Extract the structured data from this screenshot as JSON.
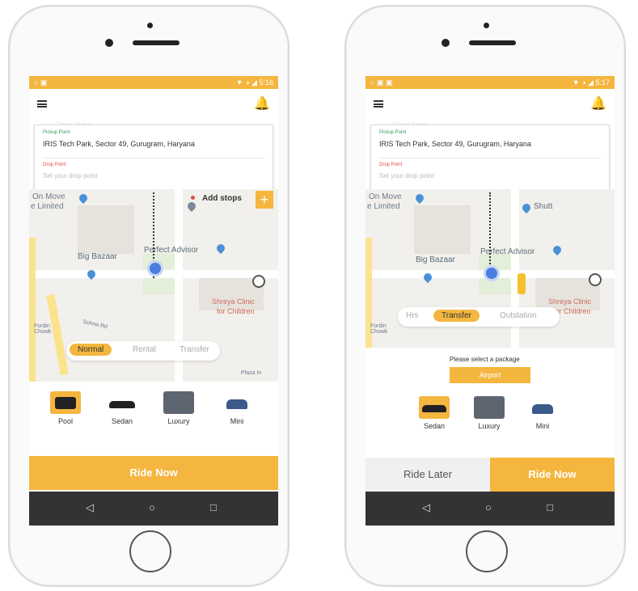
{
  "colors": {
    "accent": "#f4b63f",
    "nav_bar": "#333333",
    "pickup_label": "#3a9b58",
    "drop_label": "#e24b4b"
  },
  "left": {
    "status": {
      "left": "○ ▣",
      "right": "▼ ◑ ◢ 5:16"
    },
    "pickup_label": "Pickup Point",
    "pickup_value": "IRIS Tech Park, Sector 49, Gurugram, Haryana",
    "drop_label": "Drop Point",
    "drop_placeholder": "Set your drop point",
    "add_stops": "Add stops",
    "map_labels": {
      "on_move": "On Move",
      "limited": "e Limited",
      "big_bazaar": "Big Bazaar",
      "perfect_advisor": "Perfect Advisor",
      "clinic1": "Shreya Clinic",
      "clinic2": "for Children",
      "fordin": "Fordin Chowk",
      "sohna": "Sohna Rd",
      "plaza": "Plaza In",
      "top_faint": "Cibera Nebia"
    },
    "tabs": [
      {
        "label": "Normal",
        "active": true
      },
      {
        "label": "Rental",
        "active": false
      },
      {
        "label": "Transfer",
        "active": false
      }
    ],
    "cars": [
      {
        "label": "Pool",
        "icon": "suv-icon",
        "selected": true
      },
      {
        "label": "Sedan",
        "icon": "sedan-icon",
        "selected": false
      },
      {
        "label": "Luxury",
        "icon": "luxury-car-icon",
        "selected": false
      },
      {
        "label": "Mini",
        "icon": "mini-car-icon",
        "selected": false
      }
    ],
    "ride_now": "Ride Now"
  },
  "right": {
    "status": {
      "left": "○ ▣ ▣",
      "right": "▼ ◑ ◢ 5:17"
    },
    "pickup_label": "Pickup Point",
    "pickup_value": "IRIS Tech Park, Sector 49, Gurugram, Haryana",
    "drop_label": "Drop Point",
    "drop_placeholder": "Set your drop point",
    "map_labels": {
      "on_move": "On Move",
      "limited": "e Limited",
      "shutt": "Shutt",
      "big_bazaar": "Big Bazaar",
      "perfect_advisor": "Perfect Advisor",
      "clinic1": "Shreya Clinic",
      "clinic2": "for Children",
      "fordin": "Fordin Chowk",
      "top_faint": "Cibera Nebia"
    },
    "tabs": [
      {
        "label": "Hrs",
        "active": false
      },
      {
        "label": "Transfer",
        "active": true
      },
      {
        "label": "Outstation",
        "active": false
      }
    ],
    "package_prompt": "Please select a package",
    "package_button": "Airport",
    "cars": [
      {
        "label": "Sedan",
        "icon": "sedan-icon",
        "selected": true
      },
      {
        "label": "Luxury",
        "icon": "luxury-car-icon",
        "selected": false
      },
      {
        "label": "Mini",
        "icon": "mini-car-icon",
        "selected": false
      }
    ],
    "ride_later": "Ride Later",
    "ride_now": "Ride Now"
  },
  "nav": {
    "back": "◁",
    "home": "○",
    "recent": "□"
  }
}
